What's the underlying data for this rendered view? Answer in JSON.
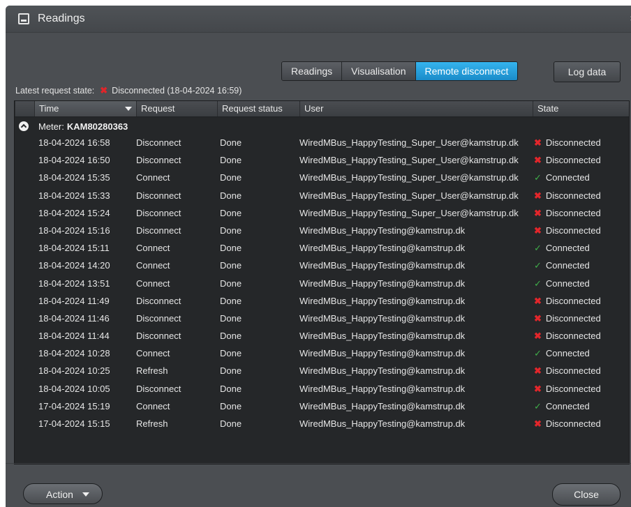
{
  "window": {
    "title": "Readings",
    "icon": "window-icon"
  },
  "tabs": [
    {
      "label": "Readings",
      "active": false
    },
    {
      "label": "Visualisation",
      "active": false
    },
    {
      "label": "Remote disconnect",
      "active": true
    }
  ],
  "log_button": "Log data",
  "latest_state": {
    "label": "Latest request state:",
    "value": "Disconnected (18-04-2024 16:59)"
  },
  "columns": [
    "Time",
    "Request",
    "Request status",
    "User",
    "State"
  ],
  "group": {
    "label": "Meter:",
    "id": "KAM80280363"
  },
  "rows": [
    {
      "time": "18-04-2024 16:58",
      "request": "Disconnect",
      "status": "Done",
      "user": "WiredMBus_HappyTesting_Super_User@kamstrup.dk",
      "state": "Disconnected"
    },
    {
      "time": "18-04-2024 16:50",
      "request": "Disconnect",
      "status": "Done",
      "user": "WiredMBus_HappyTesting_Super_User@kamstrup.dk",
      "state": "Disconnected"
    },
    {
      "time": "18-04-2024 15:35",
      "request": "Connect",
      "status": "Done",
      "user": "WiredMBus_HappyTesting_Super_User@kamstrup.dk",
      "state": "Connected"
    },
    {
      "time": "18-04-2024 15:33",
      "request": "Disconnect",
      "status": "Done",
      "user": "WiredMBus_HappyTesting_Super_User@kamstrup.dk",
      "state": "Disconnected"
    },
    {
      "time": "18-04-2024 15:24",
      "request": "Disconnect",
      "status": "Done",
      "user": "WiredMBus_HappyTesting_Super_User@kamstrup.dk",
      "state": "Disconnected"
    },
    {
      "time": "18-04-2024 15:16",
      "request": "Disconnect",
      "status": "Done",
      "user": "WiredMBus_HappyTesting@kamstrup.dk",
      "state": "Disconnected"
    },
    {
      "time": "18-04-2024 15:11",
      "request": "Connect",
      "status": "Done",
      "user": "WiredMBus_HappyTesting@kamstrup.dk",
      "state": "Connected"
    },
    {
      "time": "18-04-2024 14:20",
      "request": "Connect",
      "status": "Done",
      "user": "WiredMBus_HappyTesting@kamstrup.dk",
      "state": "Connected"
    },
    {
      "time": "18-04-2024 13:51",
      "request": "Connect",
      "status": "Done",
      "user": "WiredMBus_HappyTesting@kamstrup.dk",
      "state": "Connected"
    },
    {
      "time": "18-04-2024 11:49",
      "request": "Disconnect",
      "status": "Done",
      "user": "WiredMBus_HappyTesting@kamstrup.dk",
      "state": "Disconnected"
    },
    {
      "time": "18-04-2024 11:46",
      "request": "Disconnect",
      "status": "Done",
      "user": "WiredMBus_HappyTesting@kamstrup.dk",
      "state": "Disconnected"
    },
    {
      "time": "18-04-2024 11:44",
      "request": "Disconnect",
      "status": "Done",
      "user": "WiredMBus_HappyTesting@kamstrup.dk",
      "state": "Disconnected"
    },
    {
      "time": "18-04-2024 10:28",
      "request": "Connect",
      "status": "Done",
      "user": "WiredMBus_HappyTesting@kamstrup.dk",
      "state": "Connected"
    },
    {
      "time": "18-04-2024 10:25",
      "request": "Refresh",
      "status": "Done",
      "user": "WiredMBus_HappyTesting@kamstrup.dk",
      "state": "Disconnected"
    },
    {
      "time": "18-04-2024 10:05",
      "request": "Disconnect",
      "status": "Done",
      "user": "WiredMBus_HappyTesting@kamstrup.dk",
      "state": "Disconnected"
    },
    {
      "time": "17-04-2024 15:19",
      "request": "Connect",
      "status": "Done",
      "user": "WiredMBus_HappyTesting@kamstrup.dk",
      "state": "Connected"
    },
    {
      "time": "17-04-2024 15:15",
      "request": "Refresh",
      "status": "Done",
      "user": "WiredMBus_HappyTesting@kamstrup.dk",
      "state": "Disconnected"
    }
  ],
  "footer": {
    "action_label": "Action",
    "close_label": "Close"
  },
  "colors": {
    "accent": "#1a8bc9",
    "disconnected": "#e3262b",
    "connected": "#3fae49"
  }
}
